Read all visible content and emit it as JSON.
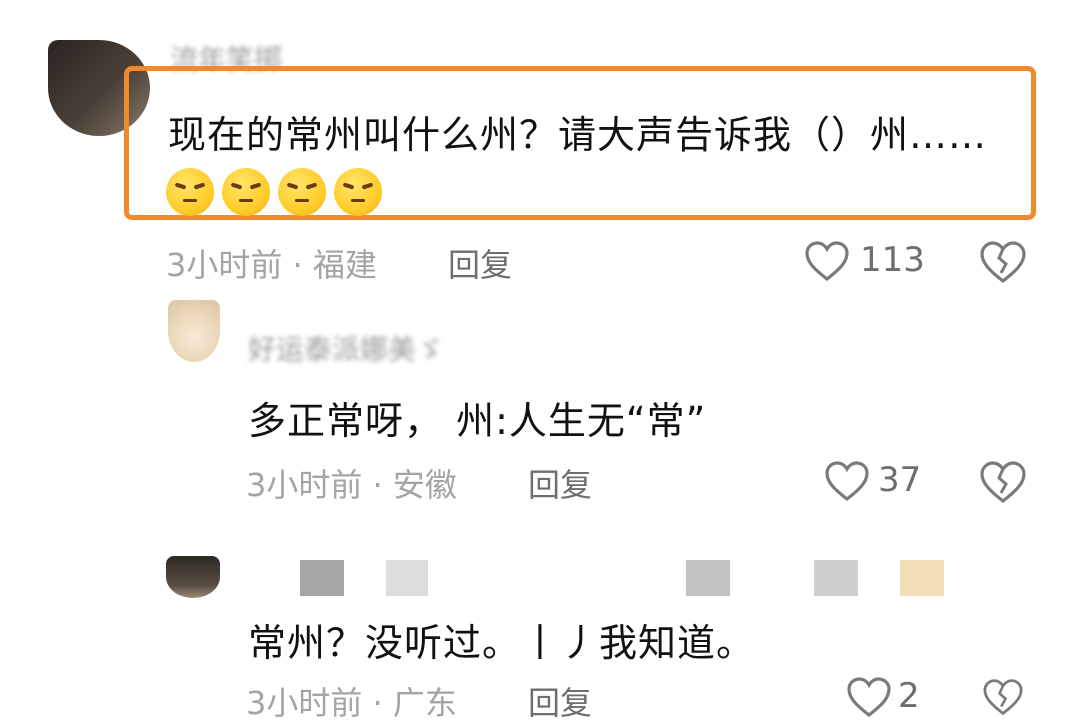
{
  "comments": [
    {
      "username": "流年笑掷",
      "text": "现在的常州叫什么州？请大声告诉我（）州……",
      "emojis": [
        "squint-annoyed-emoji",
        "squint-annoyed-emoji",
        "squint-annoyed-emoji",
        "squint-annoyed-emoji"
      ],
      "meta": "3小时前 · 福建",
      "reply_label": "回复",
      "likes": "113",
      "highlight_color": "#f08a2a"
    },
    {
      "username": "好运泰派娜美ゞ",
      "text": "多正常呀， 州:人生无“常”",
      "meta": "3小时前 · 安徽",
      "reply_label": "回复",
      "likes": "37"
    },
    {
      "username": "",
      "text": "常州？没听过。丨丿我知道。",
      "meta": "3小时前 · 广东",
      "reply_label": "回复",
      "likes": "2"
    }
  ],
  "icons": {
    "like": "heart-outline-icon",
    "dislike": "broken-heart-icon"
  },
  "colors": {
    "highlight_border": "#f08a2a",
    "meta_text": "#a4a4a4",
    "action_text": "#6e6e6e"
  }
}
